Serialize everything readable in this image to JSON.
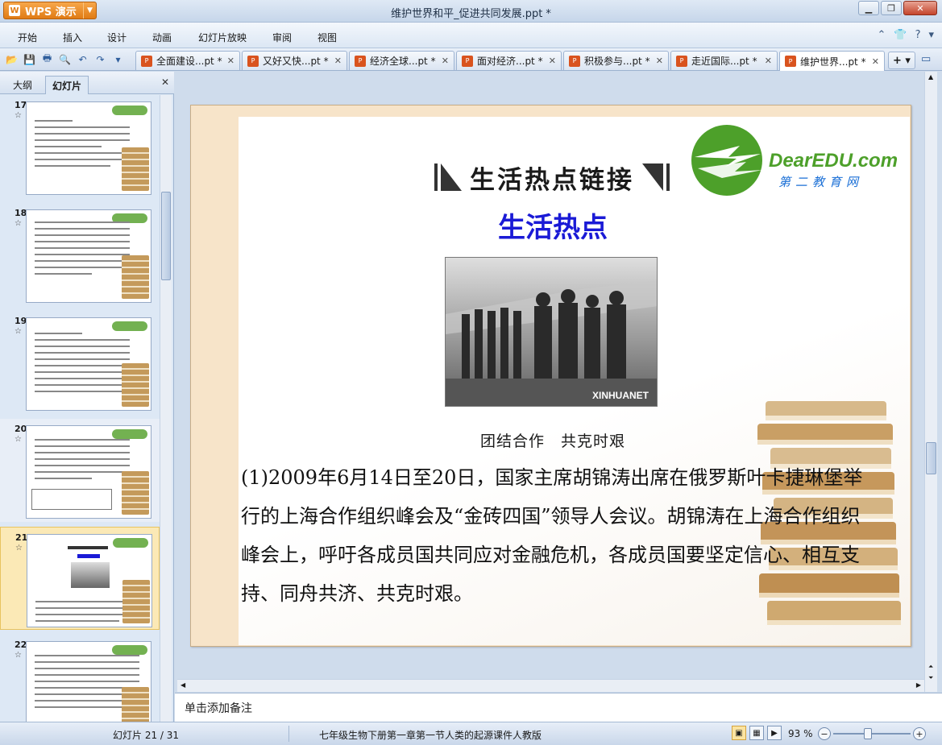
{
  "app": {
    "name": "WPS 演示",
    "window_title": "维护世界和平_促进共同发展.ppt *"
  },
  "menu": [
    "开始",
    "插入",
    "设计",
    "动画",
    "幻灯片放映",
    "审阅",
    "视图"
  ],
  "doc_tabs": [
    {
      "label": "全面建设...pt *"
    },
    {
      "label": "又好又快...pt *"
    },
    {
      "label": "经济全球...pt *"
    },
    {
      "label": "面对经济...pt *"
    },
    {
      "label": "积极参与...pt *"
    },
    {
      "label": "走近国际...pt *"
    },
    {
      "label": "维护世界...pt *",
      "active": true
    }
  ],
  "left_panel": {
    "tabs": [
      "大纲",
      "幻灯片"
    ],
    "active_tab": "幻灯片",
    "thumbnails": [
      {
        "number": "17"
      },
      {
        "number": "18"
      },
      {
        "number": "19"
      },
      {
        "number": "20"
      },
      {
        "number": "21",
        "selected": true
      },
      {
        "number": "22"
      }
    ]
  },
  "slide": {
    "heading": "生活热点链接",
    "subtitle": "生活热点",
    "logo_text": "DearEDU.com",
    "logo_sub": "第二教育网",
    "photo_watermark": "XINHUANET",
    "caption": "团结合作　共克时艰",
    "body": "(1)2009年6月14日至20日，国家主席胡锦涛出席在俄罗斯叶卡捷琳堡举行的上海合作组织峰会及“金砖四国”领导人会议。胡锦涛在上海合作组织峰会上，呼吁各成员国共同应对金融危机，各成员国要坚定信心、相互支持、同舟共济、共克时艰。"
  },
  "notes_placeholder": "单击添加备注",
  "status": {
    "slide_counter": "幻灯片 21 / 31",
    "doc_name": "七年级生物下册第一章第一节人类的起源课件人教版",
    "zoom": "93 %"
  },
  "colors": {
    "subtitle": "#1a1ad6",
    "logo_green": "#4da02a",
    "accent_orange": "#e07b14"
  }
}
